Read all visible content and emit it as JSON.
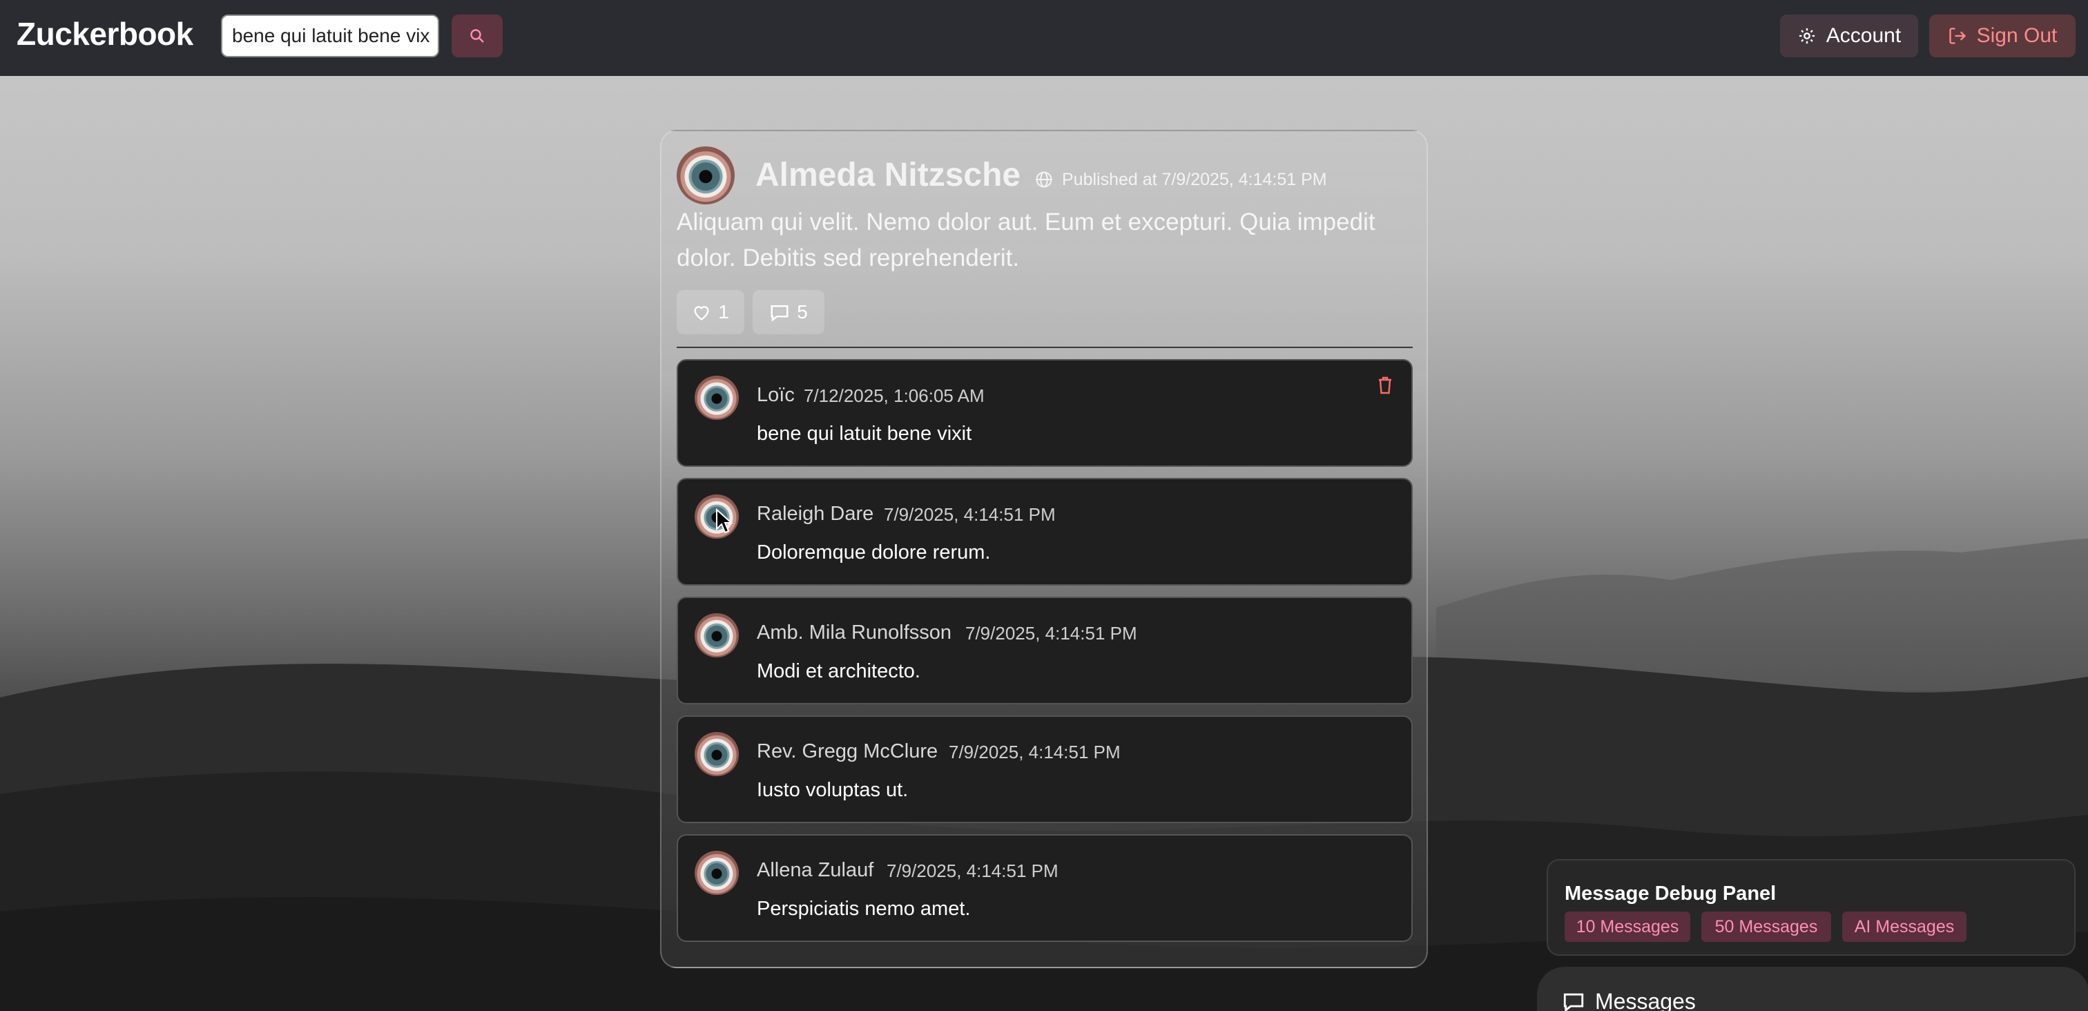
{
  "app": {
    "brand": "Zuckerbook"
  },
  "header": {
    "search_value": "bene qui latuit bene vix",
    "account_label": "Account",
    "signout_label": "Sign Out"
  },
  "post": {
    "author": "Almeda Nitzsche",
    "published": "Published at 7/9/2025, 4:14:51 PM",
    "body": "Aliquam qui velit. Nemo dolor aut. Eum et excepturi. Quia impedit dolor. Debitis sed reprehenderit.",
    "likes": "1",
    "comments_count": "5"
  },
  "comments": [
    {
      "author": "Loïc",
      "time": "7/12/2025, 1:06:05 AM",
      "text": "bene qui latuit bene vixit"
    },
    {
      "author": "Raleigh Dare",
      "time": "7/9/2025, 4:14:51 PM",
      "text": "Doloremque dolore rerum."
    },
    {
      "author": "Amb. Mila Runolfsson",
      "time": "7/9/2025, 4:14:51 PM",
      "text": "Modi et architecto."
    },
    {
      "author": "Rev. Gregg McClure",
      "time": "7/9/2025, 4:14:51 PM",
      "text": "Iusto voluptas ut."
    },
    {
      "author": "Allena Zulauf",
      "time": "7/9/2025, 4:14:51 PM",
      "text": "Perspiciatis nemo amet."
    }
  ],
  "debug": {
    "title": "Message Debug Panel",
    "buttons": [
      "10 Messages",
      "50 Messages",
      "AI Messages"
    ]
  },
  "messages": {
    "label": "Messages"
  },
  "colors": {
    "topbar": "#2a2c31",
    "accent": "#ff8fb3",
    "signout": "#ff8a8a"
  }
}
